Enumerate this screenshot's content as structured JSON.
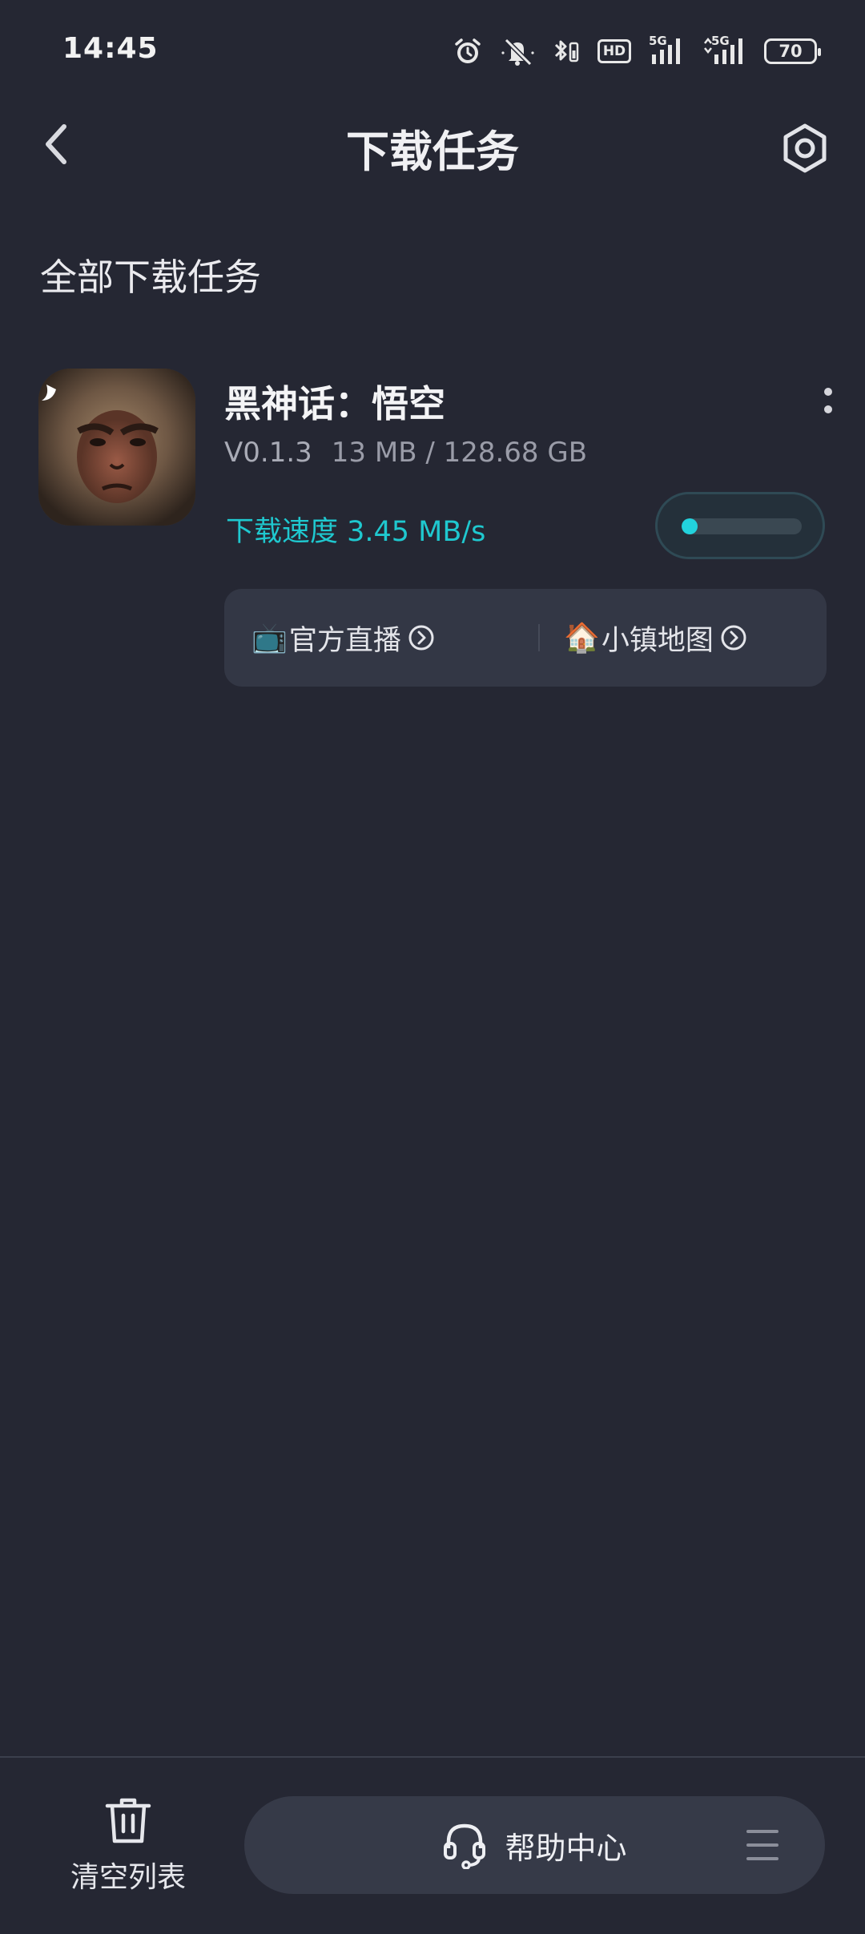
{
  "status_bar": {
    "time": "14:45",
    "hd_label": "HD",
    "net1_label": "5G",
    "net2_label": "5G",
    "battery": "70",
    "icons": [
      "alarm-icon",
      "mute-icon",
      "bluetooth-icon",
      "hd-icon",
      "signal-icon",
      "signal-icon",
      "battery-icon"
    ]
  },
  "header": {
    "title": "下载任务",
    "back_icon": "chevron-left-icon",
    "settings_icon": "hexagon-settings-icon"
  },
  "section": {
    "title": "全部下载任务"
  },
  "download": {
    "name": "黑神话：悟空",
    "version": "V0.1.3",
    "size": "13 MB / 128.68 GB",
    "speed": "下载速度 3.45 MB/s",
    "progress_percent": 5,
    "links": [
      {
        "emoji": "📺",
        "label": "官方直播"
      },
      {
        "emoji": "🏠",
        "label": "小镇地图"
      }
    ]
  },
  "bottom": {
    "clear_label": "清空列表",
    "help_label": "帮助中心",
    "menu_icon": "hamburger-menu-icon"
  },
  "colors": {
    "background": "#252733",
    "accent": "#22d3dd",
    "panel": "#333745"
  }
}
